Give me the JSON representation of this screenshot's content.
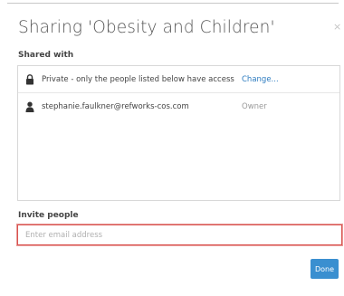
{
  "dialog": {
    "title": "Sharing 'Obesity and Children'",
    "close_icon": "close-icon",
    "close_label": "×"
  },
  "shared_with": {
    "label": "Shared with",
    "privacy": {
      "icon": "lock-icon",
      "text": "Private - only the people listed below have access",
      "action_label": "Change..."
    },
    "members": [
      {
        "icon": "user-icon",
        "email": "stephanie.faulkner@refworks-cos.com",
        "role": "Owner"
      }
    ]
  },
  "invite": {
    "label": "Invite people",
    "placeholder": "Enter email address",
    "value": ""
  },
  "footer": {
    "done_label": "Done"
  },
  "colors": {
    "accent": "#3a8fd0",
    "link": "#2e7cc0",
    "error_border": "#d9534f"
  }
}
